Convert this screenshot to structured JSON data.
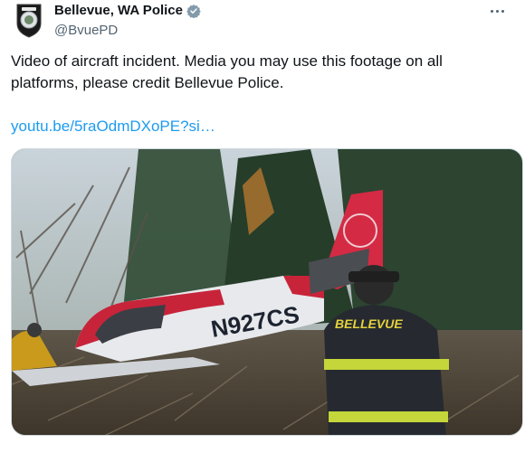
{
  "account": {
    "display_name": "Bellevue, WA Police",
    "handle": "@BvuePD",
    "verified": true
  },
  "tweet": {
    "text": "Video of aircraft incident. Media you may use this footage on all\nplatforms, please credit Bellevue Police.",
    "link_text": "youtu.be/5raOdmDXoPE?si…"
  },
  "media": {
    "tail_number": "N927CS",
    "jacket_text": "BELLEVUE"
  },
  "icons": {
    "avatar": "police-badge-icon",
    "verified": "verified-badge-icon",
    "more": "more-options-icon"
  },
  "colors": {
    "link": "#1d9bf0",
    "verified": "#829aab",
    "secondary_text": "#536471"
  }
}
